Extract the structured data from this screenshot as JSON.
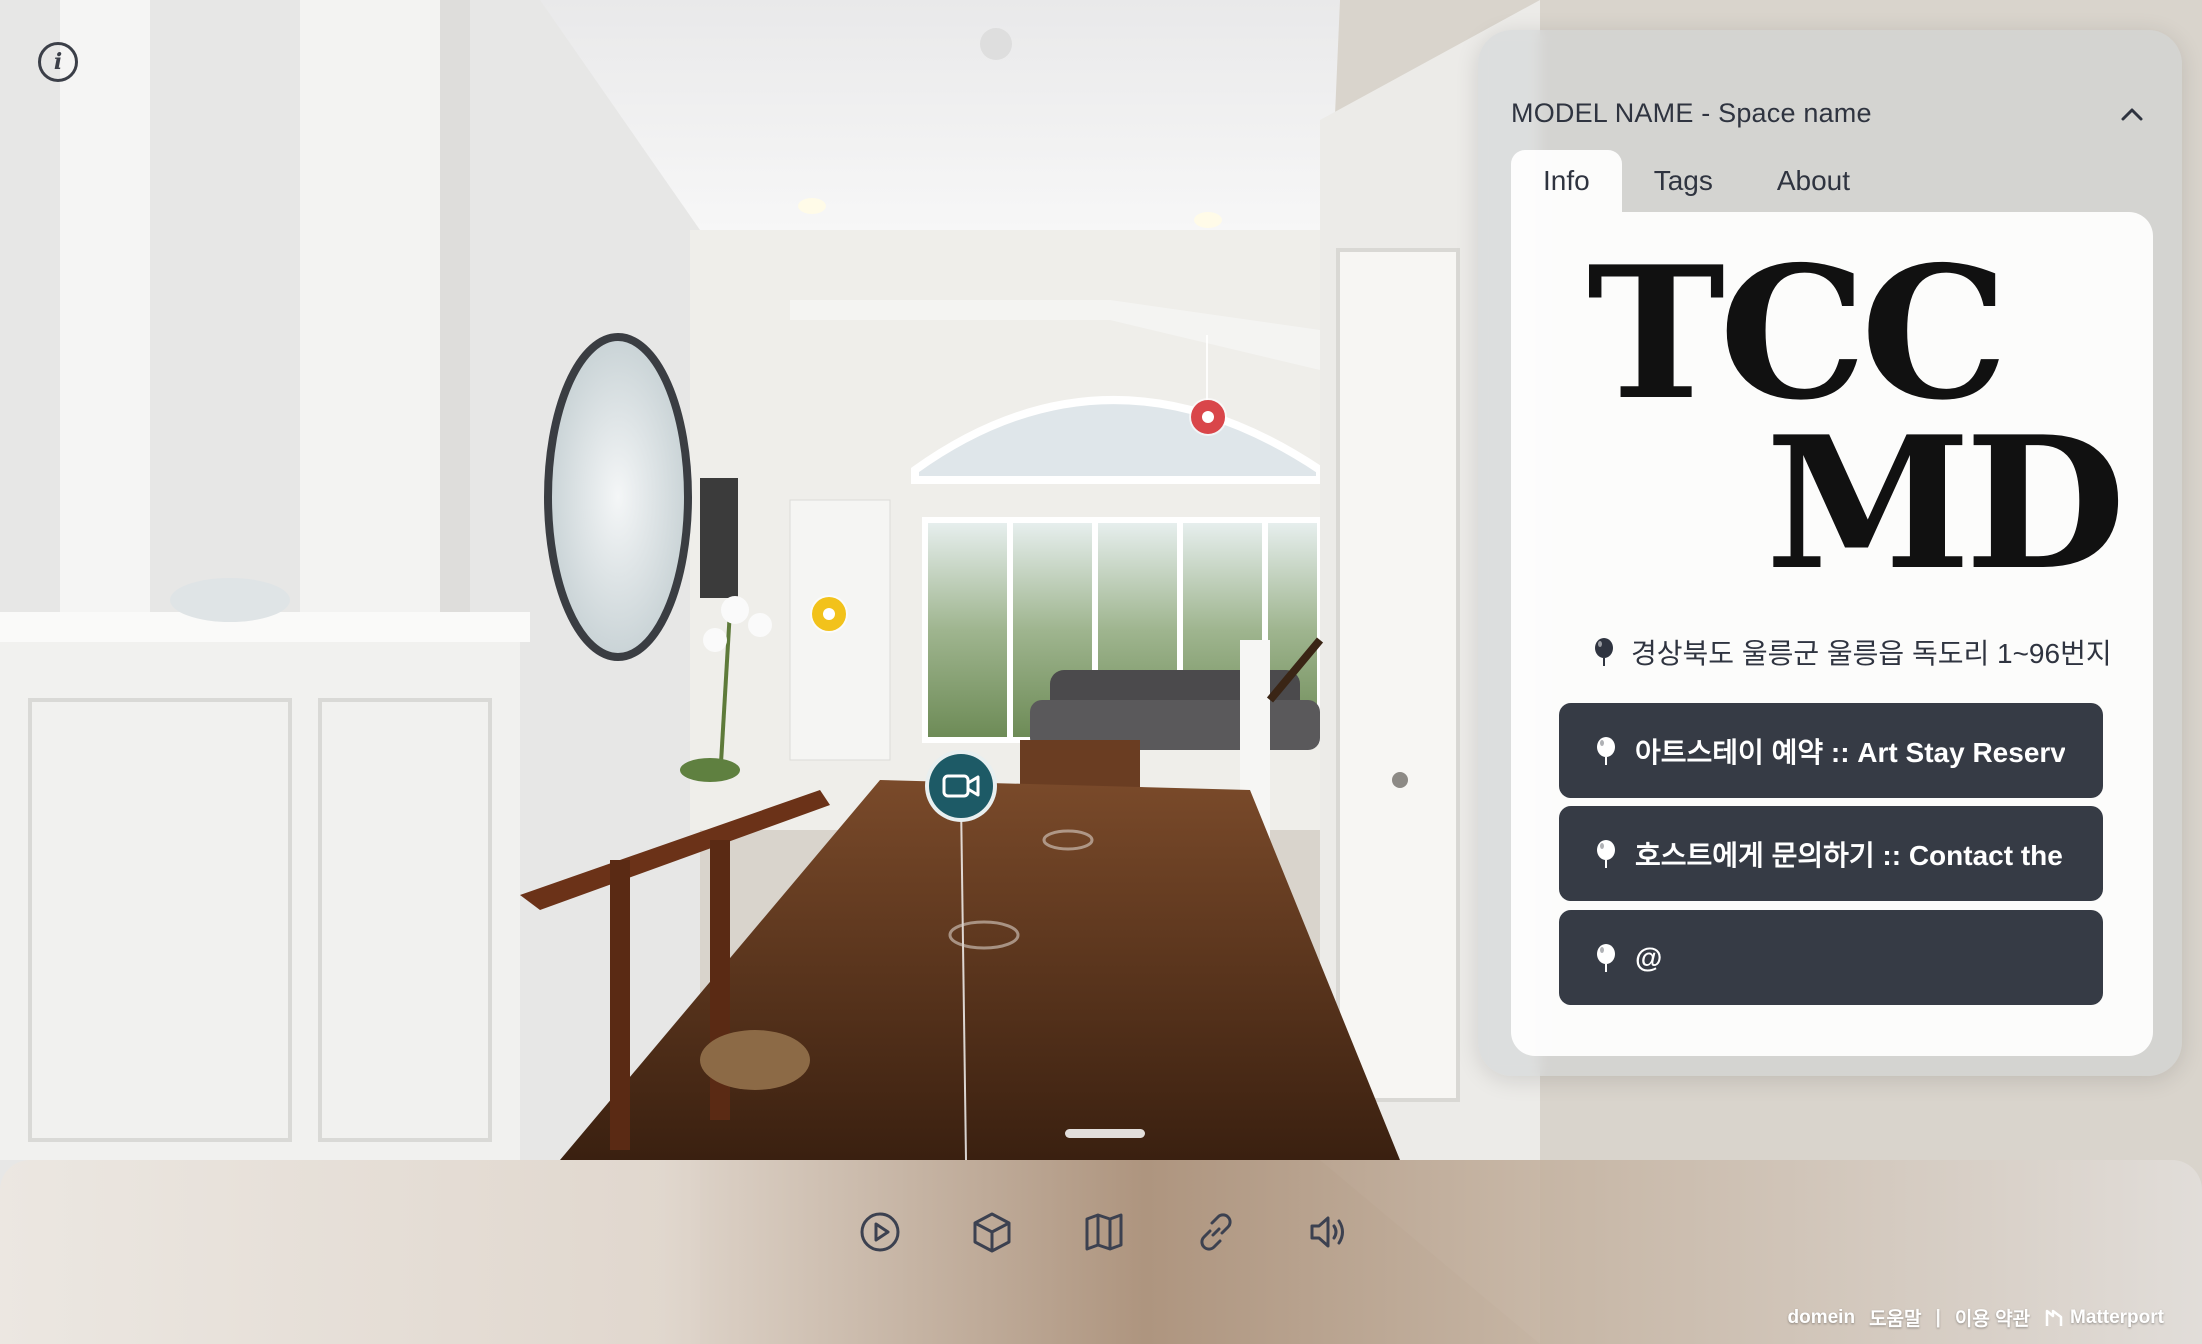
{
  "colors": {
    "panel_text": "#2f3440",
    "button_bg": "#363b45",
    "tag_red": "#d9464a",
    "tag_yellow": "#f2c21b",
    "video_tag": "#1d5a66"
  },
  "scene": {
    "icons": {
      "info": "info-icon",
      "video": "video-camera-icon",
      "tag_red": "mattertag-icon",
      "tag_yellow": "mattertag-icon"
    }
  },
  "panel": {
    "title": "MODEL NAME - Space name",
    "tabs": [
      {
        "label": "Info",
        "active": true
      },
      {
        "label": "Tags",
        "active": false
      },
      {
        "label": "About",
        "active": false
      }
    ],
    "logo": {
      "line1": "TCC",
      "line2": "MD"
    },
    "address": "경상북도 울릉군 울릉읍 독도리 1~96번지",
    "buttons": [
      {
        "label": "아트스테이 예약 :: Art Stay Reservation"
      },
      {
        "label": "호스트에게 문의하기 :: Contact the Host"
      },
      {
        "label": "@"
      }
    ]
  },
  "toolbar": {
    "tools": [
      "play-icon",
      "dollhouse-icon",
      "floorplan-icon",
      "share-link-icon",
      "sound-icon"
    ]
  },
  "footer": {
    "domain": "domein",
    "help": "도움말",
    "separator": "|",
    "terms": "이용 약관",
    "brand": "Matterport"
  }
}
